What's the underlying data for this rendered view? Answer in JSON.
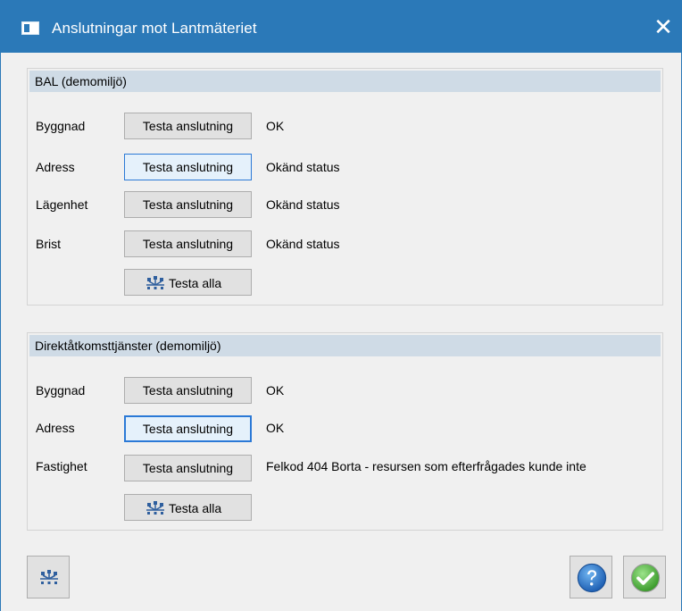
{
  "window": {
    "title": "Anslutningar mot Lantmäteriet",
    "close_symbol": "✕",
    "app_icon": "window-app-icon"
  },
  "groups": [
    {
      "title": "BAL (demomiljö)",
      "rows": [
        {
          "label": "Byggnad",
          "button": "Testa anslutning",
          "status": "OK"
        },
        {
          "label": "Adress",
          "button": "Testa anslutning",
          "status": "Okänd status"
        },
        {
          "label": "Lägenhet",
          "button": "Testa anslutning",
          "status": "Okänd status"
        },
        {
          "label": "Brist",
          "button": "Testa anslutning",
          "status": "Okänd status"
        }
      ],
      "test_all_label": "Testa alla"
    },
    {
      "title": "Direktåtkomsttjänster (demomiljö)",
      "rows": [
        {
          "label": "Byggnad",
          "button": "Testa anslutning",
          "status": "OK"
        },
        {
          "label": "Adress",
          "button": "Testa anslutning",
          "status": "OK"
        },
        {
          "label": "Fastighet",
          "button": "Testa anslutning",
          "status": "Felkod 404 Borta - resursen som efterfrågades kunde inte"
        }
      ],
      "test_all_label": "Testa alla"
    }
  ],
  "footer": {
    "left_icon": "network-test-icon",
    "help_icon": "help-icon",
    "ok_icon": "ok-check-icon"
  },
  "colors": {
    "titlebar": "#2b79b8",
    "group_header": "#cfdbe6",
    "focus_border": "#2b79d6"
  }
}
